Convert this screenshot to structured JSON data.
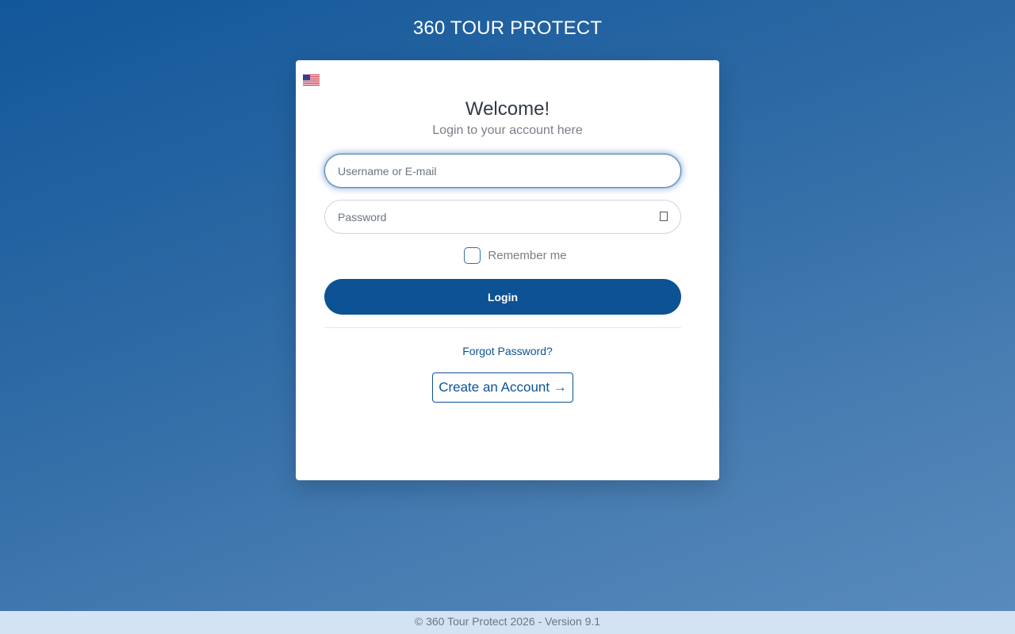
{
  "app_title": "360 TOUR PROTECT",
  "language": {
    "icon": "us-flag-icon"
  },
  "login_card": {
    "heading": "Welcome!",
    "subtitle": "Login to your account here",
    "username_placeholder": "Username or E-mail",
    "password_placeholder": "Password",
    "password_toggle_icon": "eye-icon",
    "remember_label": "Remember me",
    "login_label": "Login",
    "forgot_label": "Forgot Password?",
    "create_account_label": "Create an Account →"
  },
  "footer": {
    "text": "© 360 Tour Protect 2026 - Version 9.1"
  },
  "colors": {
    "primary": "#0c5294",
    "footer_bg": "#d4e3f3"
  }
}
